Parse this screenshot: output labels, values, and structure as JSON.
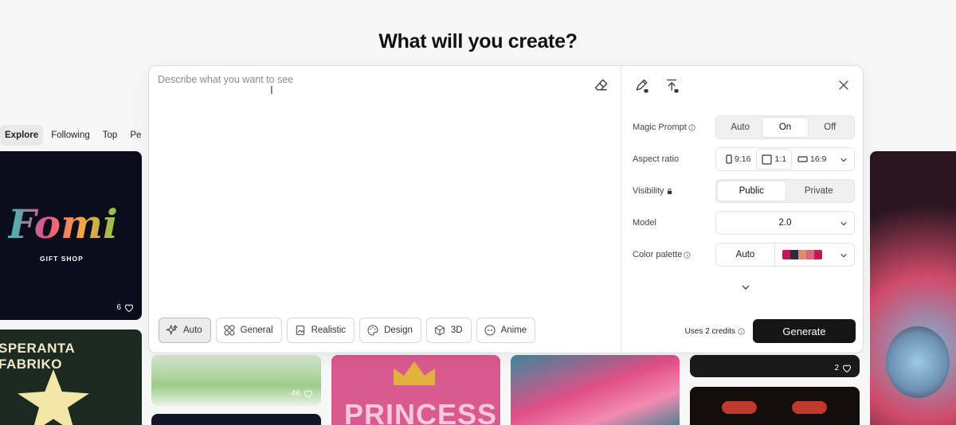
{
  "page": {
    "heading": "What will you create?"
  },
  "feed": {
    "tabs": [
      "Explore",
      "Following",
      "Top",
      "Pe"
    ],
    "cards": [
      {
        "logo_text": "Fomi",
        "logo_sub": "GIFT SHOP",
        "likes": "6"
      },
      {
        "banner_text": "SPERANTA FABRIKO"
      },
      {
        "likes": "46"
      },
      {
        "title_text": "PRINCESS"
      },
      {
        "likes": "2"
      }
    ]
  },
  "composer": {
    "prompt": {
      "placeholder": "Describe what you want to see",
      "value": ""
    },
    "styles": [
      {
        "label": "Auto",
        "icon": "sparkles-icon",
        "active": true
      },
      {
        "label": "General",
        "icon": "grid-icon",
        "active": false
      },
      {
        "label": "Realistic",
        "icon": "photo-icon",
        "active": false
      },
      {
        "label": "Design",
        "icon": "palette-icon",
        "active": false
      },
      {
        "label": "3D",
        "icon": "cube-icon",
        "active": false
      },
      {
        "label": "Anime",
        "icon": "face-icon",
        "active": false
      }
    ],
    "settings": {
      "magic_prompt": {
        "label": "Magic Prompt",
        "options": [
          "Auto",
          "On",
          "Off"
        ],
        "selected": "On"
      },
      "aspect_ratio": {
        "label": "Aspect ratio",
        "options": [
          "9:16",
          "1:1",
          "16:9"
        ],
        "selected": "1:1"
      },
      "visibility": {
        "label": "Visibility",
        "options": [
          "Public",
          "Private"
        ],
        "selected": "Public"
      },
      "model": {
        "label": "Model",
        "value": "2.0"
      },
      "color_palette": {
        "label": "Color palette",
        "value": "Auto",
        "colors": [
          "#c2185b",
          "#2b2b3a",
          "#e08a6e",
          "#d6687a",
          "#c2185b"
        ]
      }
    },
    "credits_text": "Uses 2 credits",
    "generate_label": "Generate"
  }
}
